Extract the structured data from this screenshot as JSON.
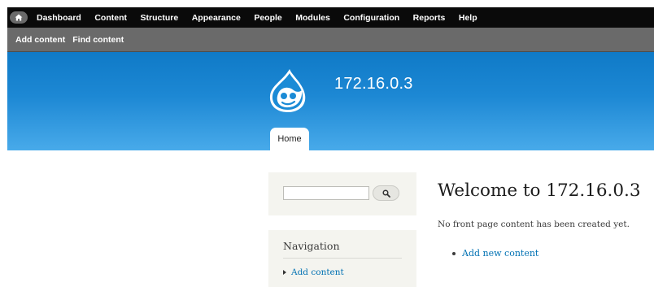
{
  "toolbar": {
    "home_icon": "home-icon",
    "menu": [
      {
        "label": "Dashboard"
      },
      {
        "label": "Content"
      },
      {
        "label": "Structure"
      },
      {
        "label": "Appearance"
      },
      {
        "label": "People"
      },
      {
        "label": "Modules"
      },
      {
        "label": "Configuration"
      },
      {
        "label": "Reports"
      },
      {
        "label": "Help"
      }
    ]
  },
  "shortcuts": [
    {
      "label": "Add content"
    },
    {
      "label": "Find content"
    }
  ],
  "header": {
    "logo_icon": "drupal-drop-logo",
    "site_name": "172.16.0.3",
    "tabs": [
      {
        "label": "Home"
      }
    ]
  },
  "sidebar": {
    "search": {
      "value": "",
      "button_icon": "search-icon"
    },
    "navigation": {
      "title": "Navigation",
      "items": [
        {
          "label": "Add content"
        }
      ]
    }
  },
  "main": {
    "title": "Welcome to 172.16.0.3",
    "text": "No front page content has been created yet.",
    "links": [
      {
        "label": "Add new content"
      }
    ]
  },
  "colors": {
    "toolbar": "#0a0a0a",
    "shortcut_bar": "#6a6a6a",
    "header_top": "#0f7ac7",
    "header_bottom": "#48aaea",
    "link": "#0071b3",
    "sidebar_bg": "#f4f4ef"
  }
}
